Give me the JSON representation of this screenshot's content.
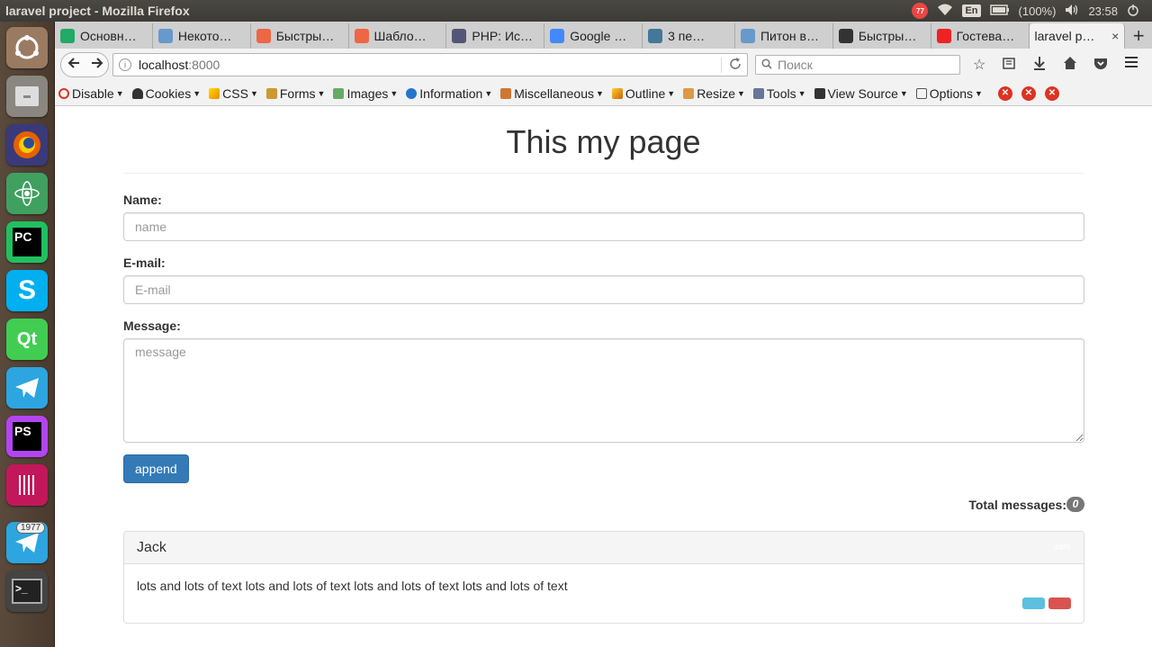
{
  "window": {
    "title": "laravel project - Mozilla Firefox"
  },
  "tray": {
    "badge": "77",
    "keyboard": "En",
    "battery": "(100%)",
    "time": "23:58"
  },
  "launcher": {
    "items": [
      "ubuntu-dash",
      "files",
      "firefox",
      "atom",
      "pycharm",
      "skype",
      "qt-creator",
      "telegram",
      "phpstorm",
      "gitkraken",
      "telegram-2",
      "terminal"
    ],
    "telegram_count": "1977"
  },
  "tabs": [
    {
      "label": "Основн…",
      "color": "#2a6"
    },
    {
      "label": "Некото…",
      "color": "#69c"
    },
    {
      "label": "Быстры…",
      "color": "#e64"
    },
    {
      "label": "Шабло…",
      "color": "#e64"
    },
    {
      "label": "PHP: Ис…",
      "color": "#557"
    },
    {
      "label": "Google …",
      "color": "#48f"
    },
    {
      "label": "3 пе…",
      "color": "#479"
    },
    {
      "label": "Питон в…",
      "color": "#69c"
    },
    {
      "label": "Быстры…",
      "color": "#333"
    },
    {
      "label": "Гостева…",
      "color": "#e22"
    }
  ],
  "active_tab": {
    "label": "laravel p…",
    "close": "×"
  },
  "new_tab": "+",
  "nav": {
    "url_host": "localhost",
    "url_port": ":8000",
    "search_placeholder": "Поиск"
  },
  "webdev": {
    "items": [
      "Disable",
      "Cookies",
      "CSS",
      "Forms",
      "Images",
      "Information",
      "Miscellaneous",
      "Outline",
      "Resize",
      "Tools",
      "View Source",
      "Options"
    ]
  },
  "page": {
    "title": "This my page",
    "name_label": "Name:",
    "name_placeholder": "name",
    "email_label": "E-mail:",
    "email_placeholder": "E-mail",
    "message_label": "Message:",
    "message_placeholder": "message",
    "append_label": "append",
    "total_label": "Total messages:",
    "total_count": "0"
  },
  "message": {
    "author": "Jack",
    "date": "date",
    "text": "lots and lots of text lots and lots of text lots and lots of text lots and lots of text"
  },
  "colors": {
    "primary": "#337ab7",
    "info": "#5bc0de",
    "danger": "#d9534f",
    "badge": "#777777"
  }
}
